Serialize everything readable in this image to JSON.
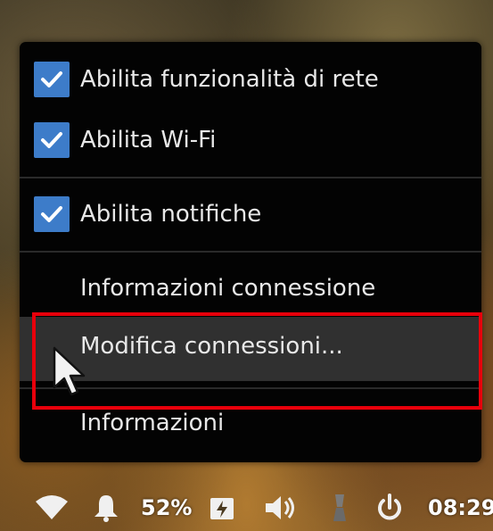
{
  "menu": {
    "items": [
      {
        "label": "Abilita funzionalità di rete",
        "checked": true
      },
      {
        "label": "Abilita Wi-Fi",
        "checked": true
      },
      {
        "label": "Abilita notifiche",
        "checked": true
      },
      {
        "label": "Informazioni connessione",
        "checked": false
      },
      {
        "label": "Modifica connessioni...",
        "checked": false,
        "hovered": true
      },
      {
        "label": "Informazioni",
        "checked": false
      }
    ]
  },
  "taskbar": {
    "battery_percent": "52%",
    "clock": "08:29",
    "icons": [
      "wifi-icon",
      "notification-bell-icon",
      "battery-charging-icon",
      "volume-icon",
      "brush-icon",
      "power-icon"
    ]
  },
  "colors": {
    "menu_bg": "#030303",
    "checkbox": "#3d7cc9",
    "hover": "#303030",
    "highlight": "#e8000b"
  }
}
